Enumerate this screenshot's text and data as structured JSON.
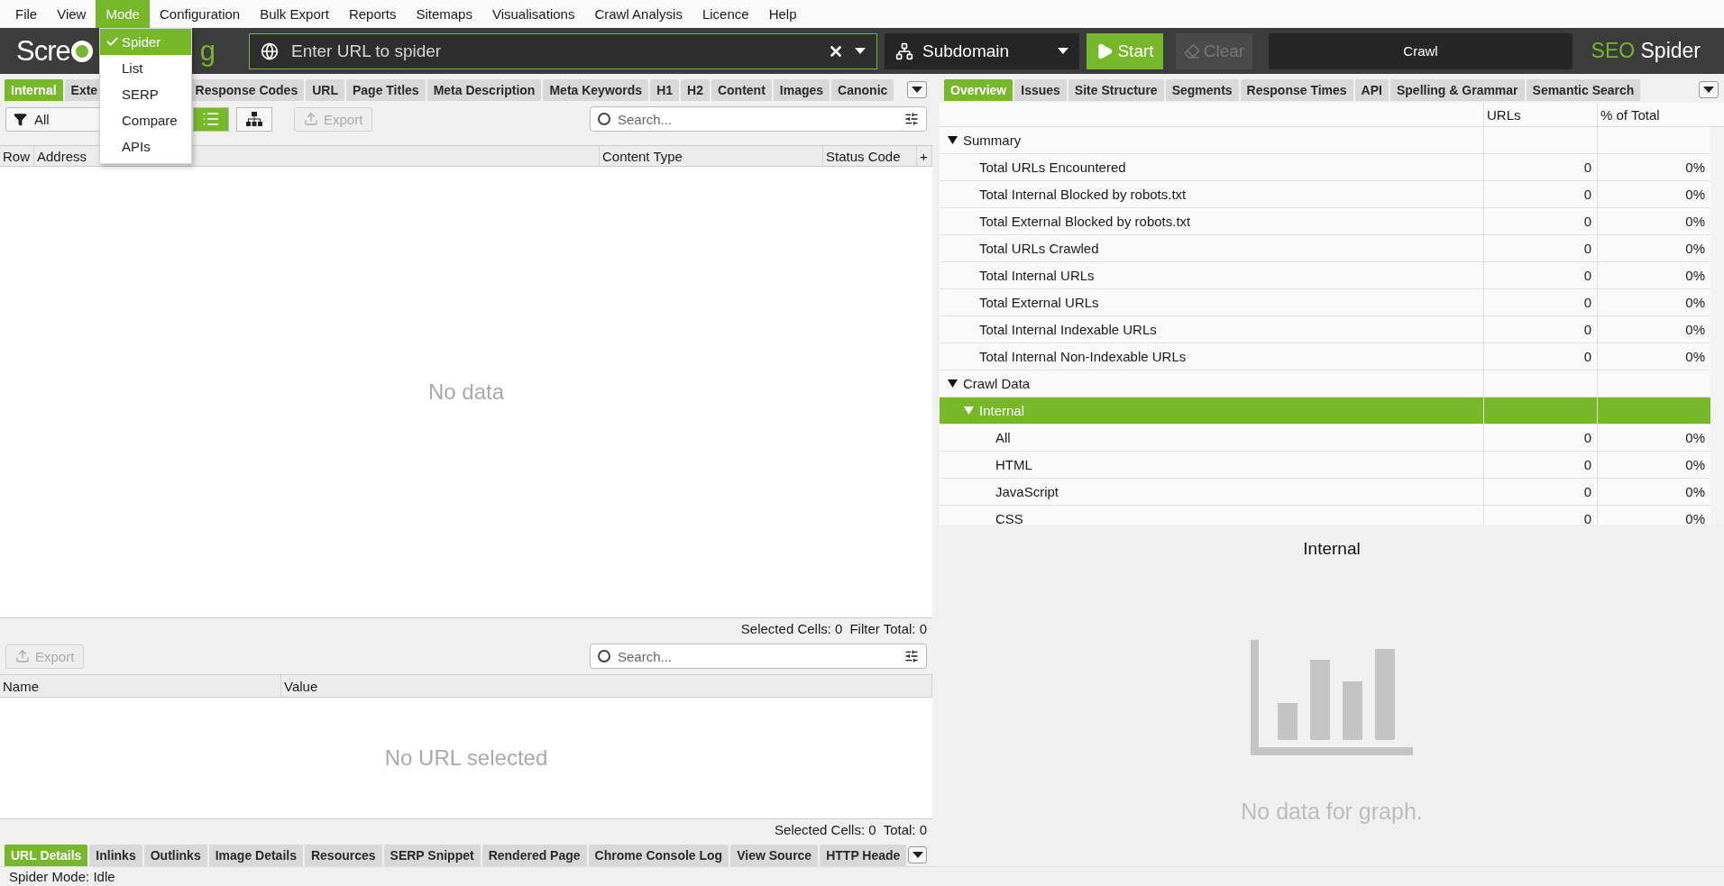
{
  "menu_bar": [
    {
      "label": "File",
      "selected": false
    },
    {
      "label": "View",
      "selected": false
    },
    {
      "label": "Mode",
      "selected": true
    },
    {
      "label": "Configuration",
      "selected": false
    },
    {
      "label": "Bulk Export",
      "selected": false
    },
    {
      "label": "Reports",
      "selected": false
    },
    {
      "label": "Sitemaps",
      "selected": false
    },
    {
      "label": "Visualisations",
      "selected": false
    },
    {
      "label": "Crawl Analysis",
      "selected": false
    },
    {
      "label": "Licence",
      "selected": false
    },
    {
      "label": "Help",
      "selected": false
    }
  ],
  "mode_menu": [
    {
      "label": "Spider",
      "checked": true,
      "selected": true
    },
    {
      "label": "List",
      "checked": false,
      "selected": false
    },
    {
      "label": "SERP",
      "checked": false,
      "selected": false
    },
    {
      "label": "Compare",
      "checked": false,
      "selected": false
    },
    {
      "label": "APIs",
      "checked": false,
      "selected": false
    }
  ],
  "toolbar": {
    "logo": {
      "left": "Scre",
      "right": "g"
    },
    "url_field": {
      "placeholder": "Enter URL to spider"
    },
    "scope": "Subdomain",
    "start": {
      "label": "Start",
      "disabled": false
    },
    "clear": {
      "label": "Clear",
      "disabled": true
    },
    "crawl_bar": {
      "label": "Crawl",
      "level": 0
    },
    "brand": {
      "accent": "SEO",
      "rest": "Spider"
    }
  },
  "left_tabs": [
    {
      "label": "Internal",
      "selected": true
    },
    {
      "label": "Exte",
      "selected": false,
      "cut": true
    },
    {
      "label": "Response Codes",
      "selected": false
    },
    {
      "label": "URL",
      "selected": false
    },
    {
      "label": "Page Titles",
      "selected": false
    },
    {
      "label": "Meta Description",
      "selected": false
    },
    {
      "label": "Meta Keywords",
      "selected": false
    },
    {
      "label": "H1",
      "selected": false
    },
    {
      "label": "H2",
      "selected": false
    },
    {
      "label": "Content",
      "selected": false
    },
    {
      "label": "Images",
      "selected": false
    },
    {
      "label": "Canonic",
      "selected": false
    }
  ],
  "filter_bar": {
    "filter": "All",
    "views": [
      {
        "kind": "list",
        "selected": true
      },
      {
        "kind": "tree",
        "selected": false
      }
    ],
    "export": {
      "label": "Export",
      "disabled": true
    },
    "search": {
      "placeholder": "Search..."
    }
  },
  "main_table": {
    "columns": [
      "Row",
      "Address",
      "Content Type",
      "Status Code",
      "+"
    ],
    "empty_text": "No data",
    "selected_cells": "Selected Cells: 0",
    "filter_total": "Filter Total: 0"
  },
  "details": {
    "export": {
      "label": "Export",
      "disabled": true
    },
    "search": {
      "placeholder": "Search..."
    },
    "columns": [
      "Name",
      "Value"
    ],
    "empty_text": "No URL selected",
    "selected_cells": "Selected Cells: 0",
    "total": "Total: 0"
  },
  "bottom_tabs": [
    {
      "label": "URL Details",
      "selected": true
    },
    {
      "label": "Inlinks",
      "selected": false
    },
    {
      "label": "Outlinks",
      "selected": false
    },
    {
      "label": "Image Details",
      "selected": false
    },
    {
      "label": "Resources",
      "selected": false
    },
    {
      "label": "SERP Snippet",
      "selected": false
    },
    {
      "label": "Rendered Page",
      "selected": false
    },
    {
      "label": "Chrome Console Log",
      "selected": false
    },
    {
      "label": "View Source",
      "selected": false
    },
    {
      "label": "HTTP Heade",
      "selected": false
    }
  ],
  "status_bar": "Spider Mode: Idle",
  "right_tabs": [
    {
      "label": "Overview",
      "selected": true
    },
    {
      "label": "Issues",
      "selected": false
    },
    {
      "label": "Site Structure",
      "selected": false
    },
    {
      "label": "Segments",
      "selected": false
    },
    {
      "label": "Response Times",
      "selected": false
    },
    {
      "label": "API",
      "selected": false
    },
    {
      "label": "Spelling & Grammar",
      "selected": false
    },
    {
      "label": "Semantic Search",
      "selected": false
    }
  ],
  "overview": {
    "columns": [
      "URLs",
      "% of Total"
    ],
    "rows": [
      {
        "label": "Summary",
        "expanded": true,
        "selected": false,
        "children": [
          {
            "label": "Total URLs Encountered",
            "urls": "0",
            "percent": "0%",
            "selected": false
          },
          {
            "label": "Total Internal Blocked by robots.txt",
            "urls": "0",
            "percent": "0%",
            "selected": false
          },
          {
            "label": "Total External Blocked by robots.txt",
            "urls": "0",
            "percent": "0%",
            "selected": false
          },
          {
            "label": "Total URLs Crawled",
            "urls": "0",
            "percent": "0%",
            "selected": false
          },
          {
            "label": "Total Internal URLs",
            "urls": "0",
            "percent": "0%",
            "selected": false
          },
          {
            "label": "Total External URLs",
            "urls": "0",
            "percent": "0%",
            "selected": false
          },
          {
            "label": "Total Internal Indexable URLs",
            "urls": "0",
            "percent": "0%",
            "selected": false
          },
          {
            "label": "Total Internal Non-Indexable URLs",
            "urls": "0",
            "percent": "0%",
            "selected": false
          }
        ]
      },
      {
        "label": "Crawl Data",
        "expanded": true,
        "selected": false,
        "children": [
          {
            "label": "Internal",
            "expanded": true,
            "selected": true,
            "children": [
              {
                "label": "All",
                "urls": "0",
                "percent": "0%",
                "selected": false
              },
              {
                "label": "HTML",
                "urls": "0",
                "percent": "0%",
                "selected": false
              },
              {
                "label": "JavaScript",
                "urls": "0",
                "percent": "0%",
                "selected": false
              },
              {
                "label": "CSS",
                "urls": "0",
                "percent": "0%",
                "selected": false
              }
            ]
          }
        ]
      }
    ]
  },
  "graph": {
    "title": "Internal",
    "empty_text": "No data for graph."
  }
}
